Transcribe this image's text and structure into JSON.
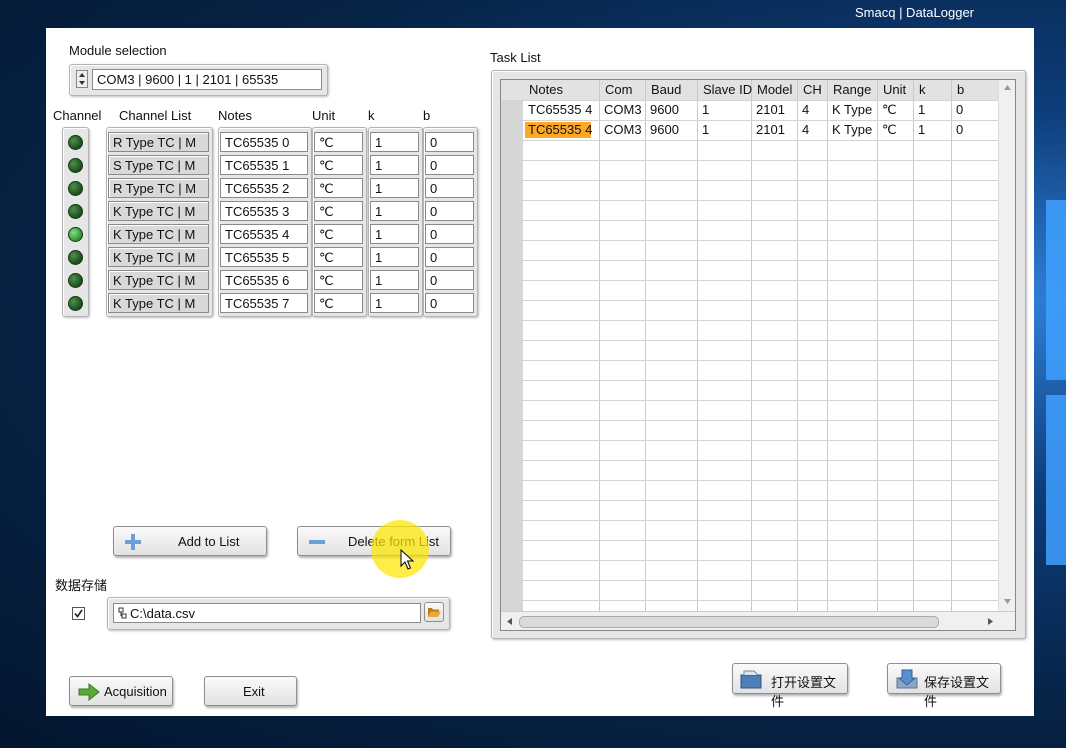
{
  "window": {
    "title": "Smacq | DataLogger"
  },
  "module": {
    "label": "Module selection",
    "value": "COM3 | 9600 | 1 | 2101 | 65535"
  },
  "channel_table": {
    "headers": {
      "channel": "Channel",
      "list": "Channel List",
      "notes": "Notes",
      "unit": "Unit",
      "k": "k",
      "b": "b"
    },
    "rows": [
      {
        "led_on": false,
        "list": "R Type TC | M",
        "notes": "TC65535 0",
        "unit": "℃",
        "k": "1",
        "b": "0"
      },
      {
        "led_on": false,
        "list": "S Type TC | M",
        "notes": "TC65535 1",
        "unit": "℃",
        "k": "1",
        "b": "0"
      },
      {
        "led_on": false,
        "list": "R Type TC | M",
        "notes": "TC65535 2",
        "unit": "℃",
        "k": "1",
        "b": "0"
      },
      {
        "led_on": false,
        "list": "K Type TC | M",
        "notes": "TC65535 3",
        "unit": "℃",
        "k": "1",
        "b": "0"
      },
      {
        "led_on": true,
        "list": "K Type TC | M",
        "notes": "TC65535 4",
        "unit": "℃",
        "k": "1",
        "b": "0"
      },
      {
        "led_on": false,
        "list": "K Type TC | M",
        "notes": "TC65535 5",
        "unit": "℃",
        "k": "1",
        "b": "0"
      },
      {
        "led_on": false,
        "list": "K Type TC | M",
        "notes": "TC65535 6",
        "unit": "℃",
        "k": "1",
        "b": "0"
      },
      {
        "led_on": false,
        "list": "K Type TC | M",
        "notes": "TC65535 7",
        "unit": "℃",
        "k": "1",
        "b": "0"
      }
    ]
  },
  "buttons": {
    "add": "Add to List",
    "delete": "Delete form List",
    "acquisition": "Acquisition",
    "exit": "Exit",
    "open_settings": "打开设置文件",
    "save_settings": "保存设置文件"
  },
  "storage": {
    "label": "数据存储",
    "checked": true,
    "path": "C:\\data.csv"
  },
  "task_list": {
    "label": "Task List",
    "columns": [
      "Notes",
      "Com",
      "Baud",
      "Slave ID",
      "Model",
      "CH",
      "Range",
      "Unit",
      "k",
      "b"
    ],
    "rows": [
      [
        "TC65535 4",
        "COM3",
        "9600",
        "1",
        "2101",
        "4",
        "K Type",
        "℃",
        "1",
        "0"
      ],
      [
        "TC65535 4",
        "COM3",
        "9600",
        "1",
        "2101",
        "4",
        "K Type",
        "℃",
        "1",
        "0"
      ]
    ],
    "highlight_color": "#ffa726"
  }
}
